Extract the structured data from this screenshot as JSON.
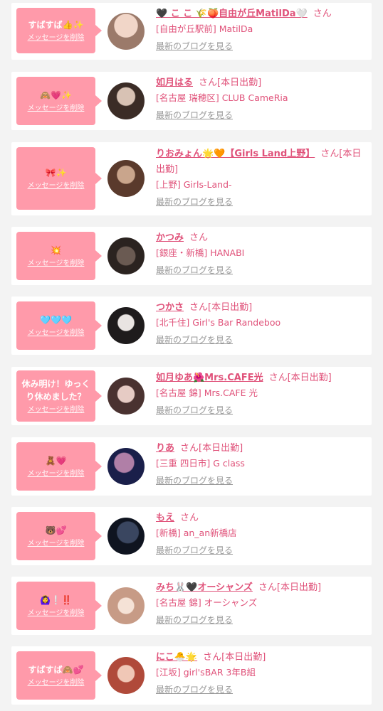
{
  "colors": {
    "bubble": "#ff9aaa",
    "link": "#e0527a",
    "muted": "#999999"
  },
  "delete_label": "メッセージを削除",
  "blog_label": "最新のブログを見る",
  "san_label": "さん",
  "items": [
    {
      "message": "すばすば👍✨",
      "name": "🖤 こ こ 🌾🍑自由が丘MatilDa🤍",
      "suffix": "",
      "shop": "[自由が丘駅前] MatilDa",
      "avatar": [
        "#f1d6c8",
        "#9b7a6a"
      ]
    },
    {
      "message": "🙈💗✨",
      "name": "如月はる",
      "suffix": "[本日出勤]",
      "shop": "[名古屋 瑞穂区] CLUB CameRia",
      "avatar": [
        "#d8c2b4",
        "#3b2c26"
      ]
    },
    {
      "message": "🎀✨",
      "name": "りおみょん🌟🧡【Girls Land上野】",
      "suffix": "[本日出勤]",
      "shop": "[上野] Girls-Land-",
      "avatar": [
        "#c9a58c",
        "#5a3a2c"
      ]
    },
    {
      "message": "💥",
      "name": "かつみ",
      "suffix": "",
      "shop": "[銀座・新橋] HANABI",
      "avatar": [
        "#6a5a52",
        "#2b2320"
      ]
    },
    {
      "message": "🩵🩵🩵",
      "name": "つかさ",
      "suffix": "[本日出勤]",
      "shop": "[北千住] Girl's Bar Randeboo",
      "avatar": [
        "#e9e4e2",
        "#1e1b1c"
      ]
    },
    {
      "message": "休み明け！ゆっくり休めました？",
      "name": "如月ゆあ🌺Mrs.CAFE光",
      "suffix": "[本日出勤]",
      "shop": "[名古屋 錦] Mrs.CAFE 光",
      "avatar": [
        "#e6cbc4",
        "#4a3230"
      ]
    },
    {
      "message": "🧸💗",
      "name": "りあ",
      "suffix": "[本日出勤]",
      "shop": "[三重 四日市] G class",
      "avatar": [
        "#b07fa7",
        "#1a1f4a"
      ]
    },
    {
      "message": "🐻💕",
      "name": "もえ",
      "suffix": "",
      "shop": "[新橋] an_an新橋店",
      "avatar": [
        "#3a4660",
        "#0f1420"
      ]
    },
    {
      "message": "🙆‍♀️❕‼️",
      "name": "みち🐰🖤オーシャンズ",
      "suffix": "[本日出勤]",
      "shop": "[名古屋 錦] オーシャンズ",
      "avatar": [
        "#f5e2d6",
        "#c79b86"
      ]
    },
    {
      "message": "すばすば🙈💕",
      "name": "にこ🐣🌟",
      "suffix": "[本日出勤]",
      "shop": "[江坂] girl'sBAR 3年B組",
      "avatar": [
        "#f0c7b6",
        "#b04a3a"
      ]
    }
  ]
}
